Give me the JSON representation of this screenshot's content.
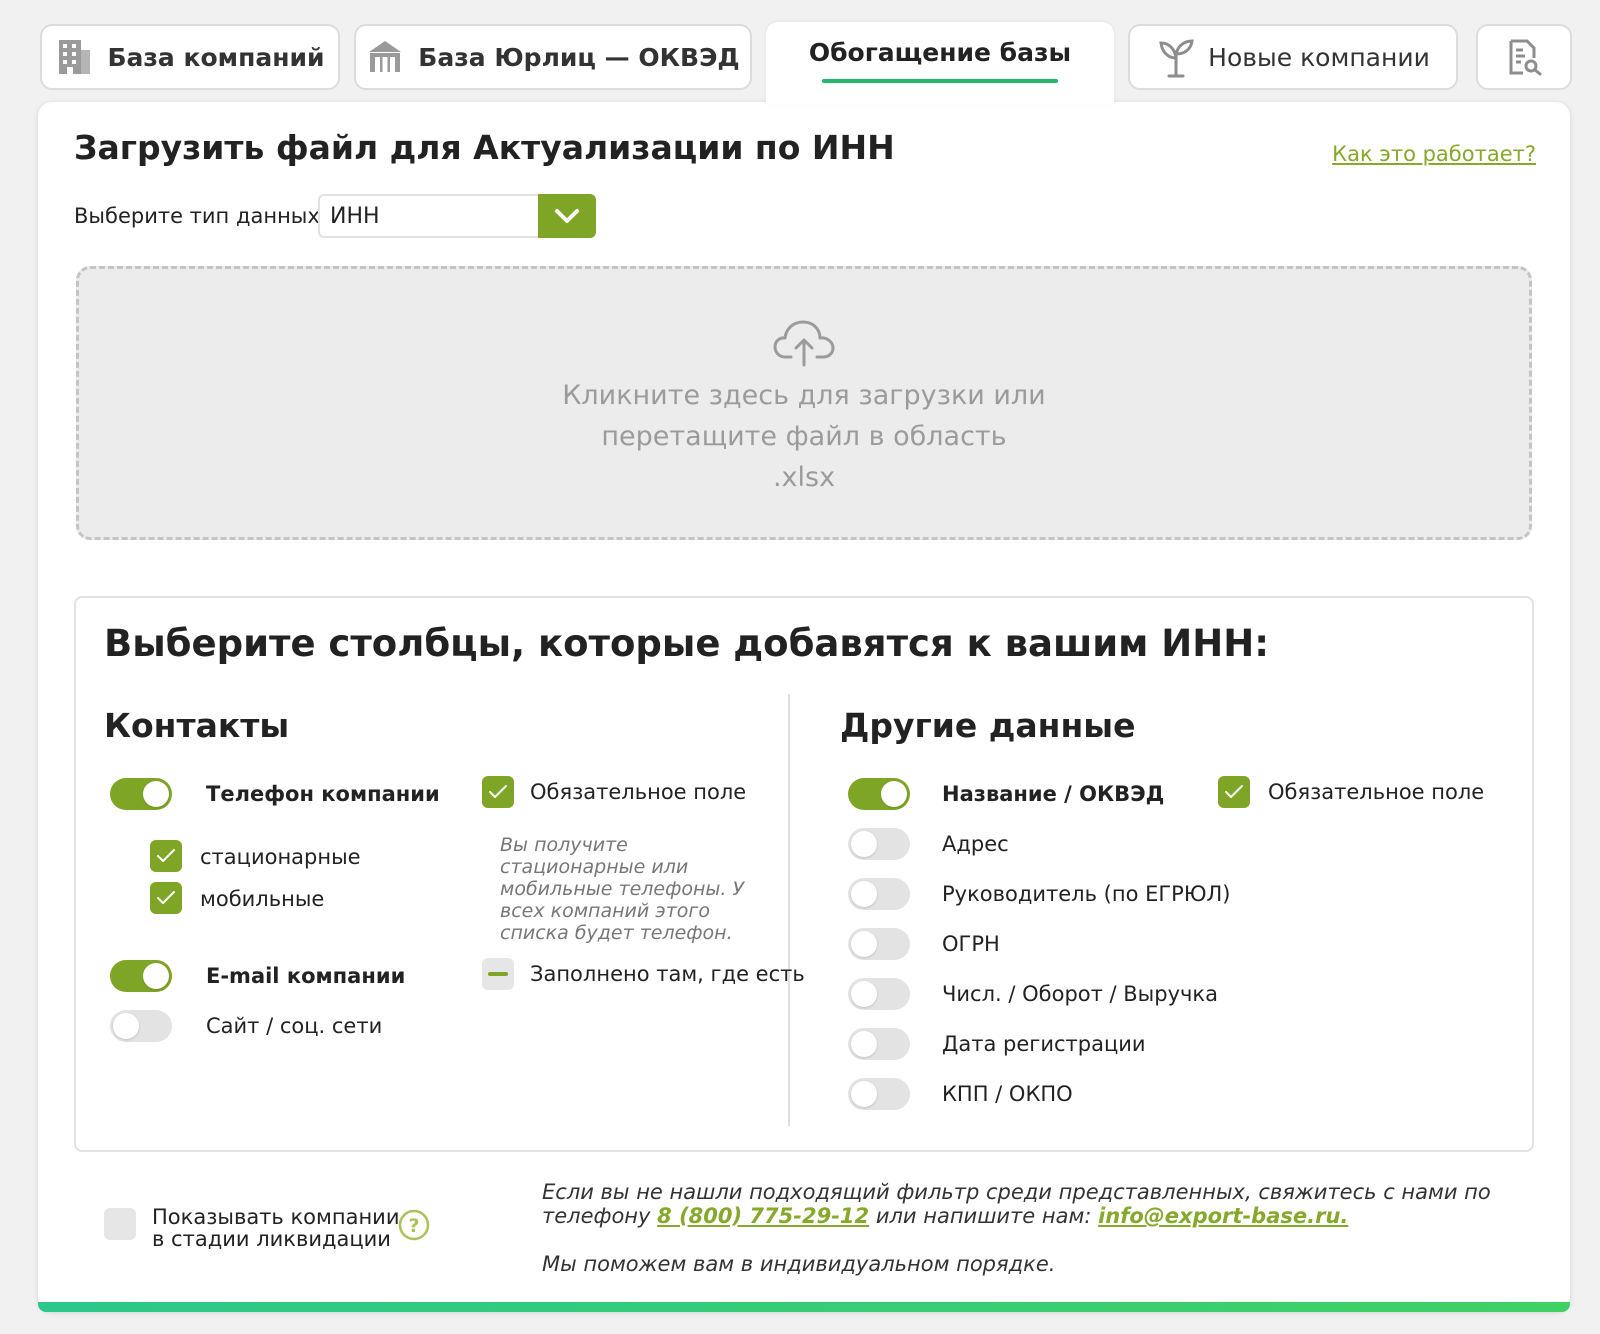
{
  "tabs": [
    {
      "label": "База компаний",
      "icon": "building-icon"
    },
    {
      "label": "База Юрлиц — ОКВЭД",
      "icon": "institution-icon"
    },
    {
      "label": "Обогащение базы",
      "active": true
    },
    {
      "label": "Новые компании",
      "icon": "sprout-icon"
    },
    {
      "label": "",
      "icon": "document-search-icon"
    }
  ],
  "upload": {
    "title": "Загрузить файл для Актуализации по ИНН",
    "how_link": "Как это работает?",
    "type_label": "Выберите тип данных:",
    "type_value": "ИНН",
    "dropzone_line1": "Кликните здесь для загрузки или",
    "dropzone_line2": "перетащите файл в область",
    "dropzone_line3": ".xlsx"
  },
  "columns": {
    "title": "Выберите столбцы, которые добавятся к вашим ИНН:",
    "contacts": {
      "title": "Контакты",
      "phone_label": "Телефон компании",
      "phone_on": true,
      "landline_label": "стационарные",
      "mobile_label": "мобильные",
      "email_label": "E-mail компании",
      "email_on": true,
      "site_label": "Сайт / соц. сети",
      "site_on": false,
      "required_label": "Обязательное поле",
      "note": "Вы получите стационарные или мобильные телефоны. У всех компаний этого списка будет телефон.",
      "filled_label": "Заполнено там, где есть"
    },
    "other": {
      "title": "Другие данные",
      "required_label": "Обязательное поле",
      "items": [
        {
          "label": "Название / ОКВЭД",
          "on": true
        },
        {
          "label": "Адрес",
          "on": false
        },
        {
          "label": "Руководитель (по ЕГРЮЛ)",
          "on": false
        },
        {
          "label": "ОГРН",
          "on": false
        },
        {
          "label": "Числ. / Оборот / Выручка",
          "on": false
        },
        {
          "label": "Дата регистрации",
          "on": false
        },
        {
          "label": "КПП / ОКПО",
          "on": false
        }
      ]
    }
  },
  "footer": {
    "liquidation_line1": "Показывать компании",
    "liquidation_line2": "в стадии ликвидации",
    "note_part1": "Если вы не нашли подходящий фильтр среди представленных, свяжитесь с нами по",
    "note_part2": "телефону",
    "phone": "8 (800) 775-29-12",
    "note_part3": "или напишите нам:",
    "email": "info@export-base.ru.",
    "help_text": "Мы поможем вам в индивидуальном порядке."
  },
  "colors": {
    "accent_green": "#7fa526",
    "link_green": "#86a82b",
    "tab_underline": "#24b56a"
  }
}
